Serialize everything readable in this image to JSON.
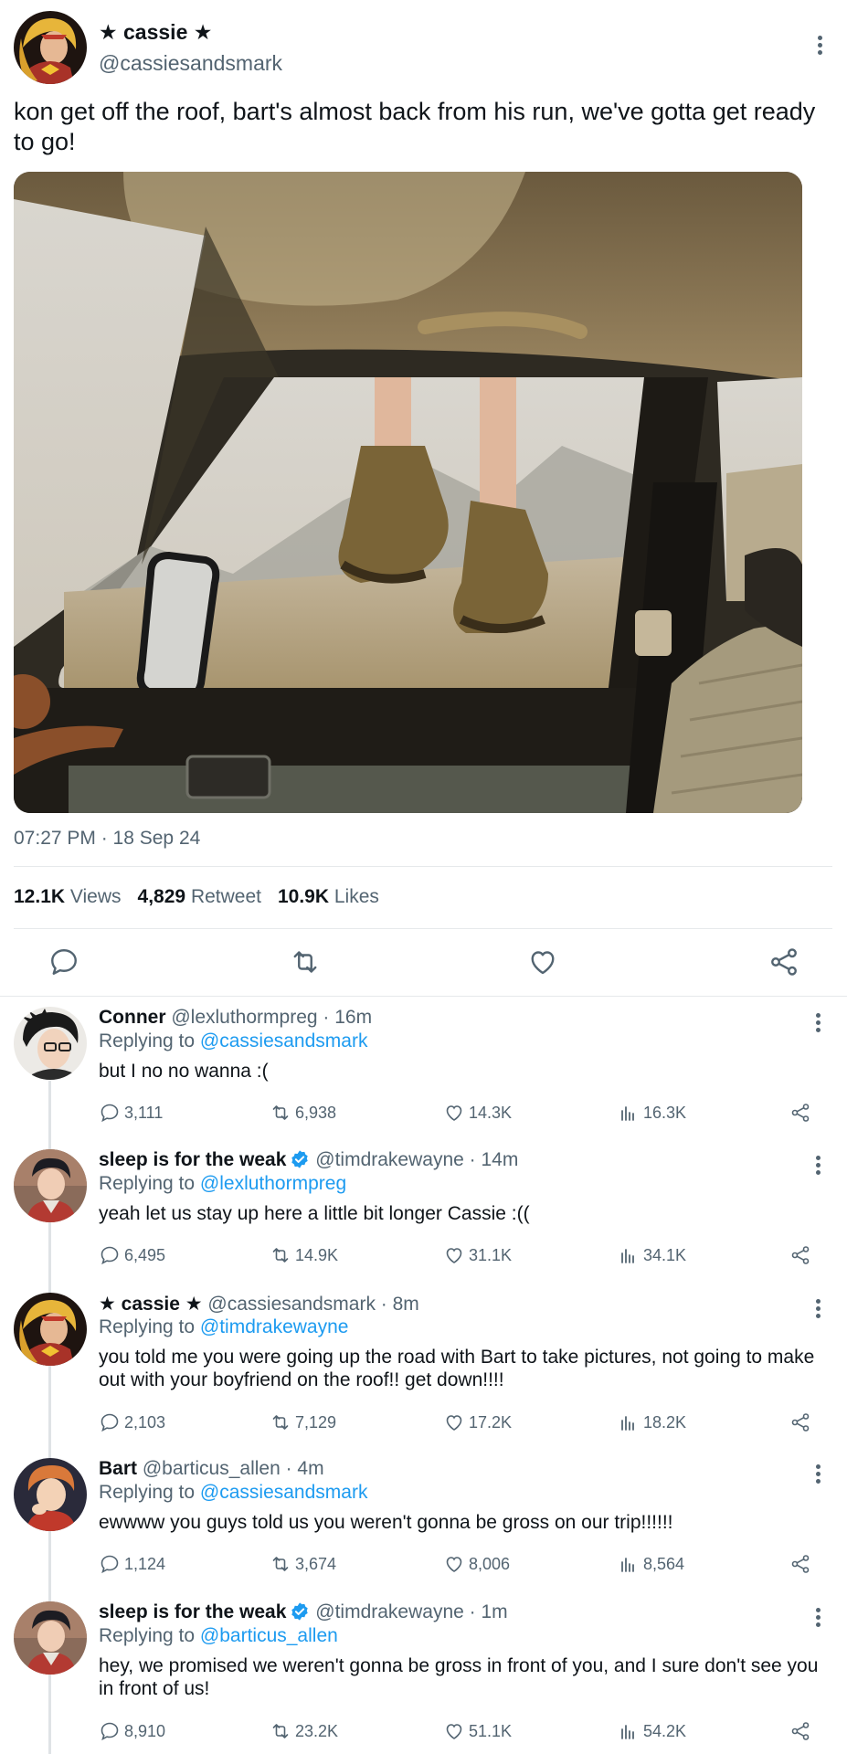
{
  "main_tweet": {
    "display_name": "★ cassie ★",
    "handle": "@cassiesandsmark",
    "text": "kon get off the roof, bart's almost back from his run, we've gotta get ready to go!",
    "timestamp": "07:27 PM · 18 Sep 24",
    "stats": {
      "views_value": "12.1K",
      "views_label": "Views",
      "retweets_value": "4,829",
      "retweets_label": "Retweet",
      "likes_value": "10.9K",
      "likes_label": "Likes"
    },
    "actions": [
      "reply-icon",
      "retweet-icon",
      "like-icon",
      "share-icon"
    ]
  },
  "replies": [
    {
      "name": "Conner",
      "verified": false,
      "handle_time": "@lexluthormpreg · 16m",
      "replying_prefix": "Replying to",
      "replying_to": "@cassiesandsmark",
      "text": "but I no no wanna :(",
      "counts": {
        "replies": "3,111",
        "retweets": "6,938",
        "likes": "14.3K",
        "views": "16.3K"
      }
    },
    {
      "name": "sleep is for the weak",
      "verified": true,
      "handle_time": "@timdrakewayne · 14m",
      "replying_prefix": "Replying to",
      "replying_to": "@lexluthormpreg",
      "text": "yeah let us stay up here a little bit longer Cassie :((",
      "counts": {
        "replies": "6,495",
        "retweets": "14.9K",
        "likes": "31.1K",
        "views": "34.1K"
      }
    },
    {
      "name": "★ cassie ★",
      "verified": false,
      "handle_time": "@cassiesandsmark · 8m",
      "replying_prefix": "Replying to",
      "replying_to": "@timdrakewayne",
      "text": "you told me you were going up the road with Bart to take pictures, not going to make out with your boyfriend on the roof!! get down!!!!",
      "counts": {
        "replies": "2,103",
        "retweets": "7,129",
        "likes": "17.2K",
        "views": "18.2K"
      }
    },
    {
      "name": "Bart",
      "verified": false,
      "handle_time": "@barticus_allen · 4m",
      "replying_prefix": "Replying to",
      "replying_to": "@cassiesandsmark",
      "text": "ewwww you guys told us you weren't gonna be gross on our trip!!!!!!",
      "counts": {
        "replies": "1,124",
        "retweets": "3,674",
        "likes": "8,006",
        "views": "8,564"
      }
    },
    {
      "name": "sleep is for the weak",
      "verified": true,
      "handle_time": "@timdrakewayne · 1m",
      "replying_prefix": "Replying to",
      "replying_to": "@barticus_allen",
      "text": "hey, we promised we weren't gonna be gross in front of you, and I sure don't see you in front of us!",
      "counts": {
        "replies": "8,910",
        "retweets": "23.2K",
        "likes": "51.1K",
        "views": "54.2K"
      }
    }
  ],
  "colors": {
    "link": "#1d9bf0",
    "secondary_text": "#536471",
    "primary_text": "#0f1419",
    "divider": "#e6e9eb"
  }
}
